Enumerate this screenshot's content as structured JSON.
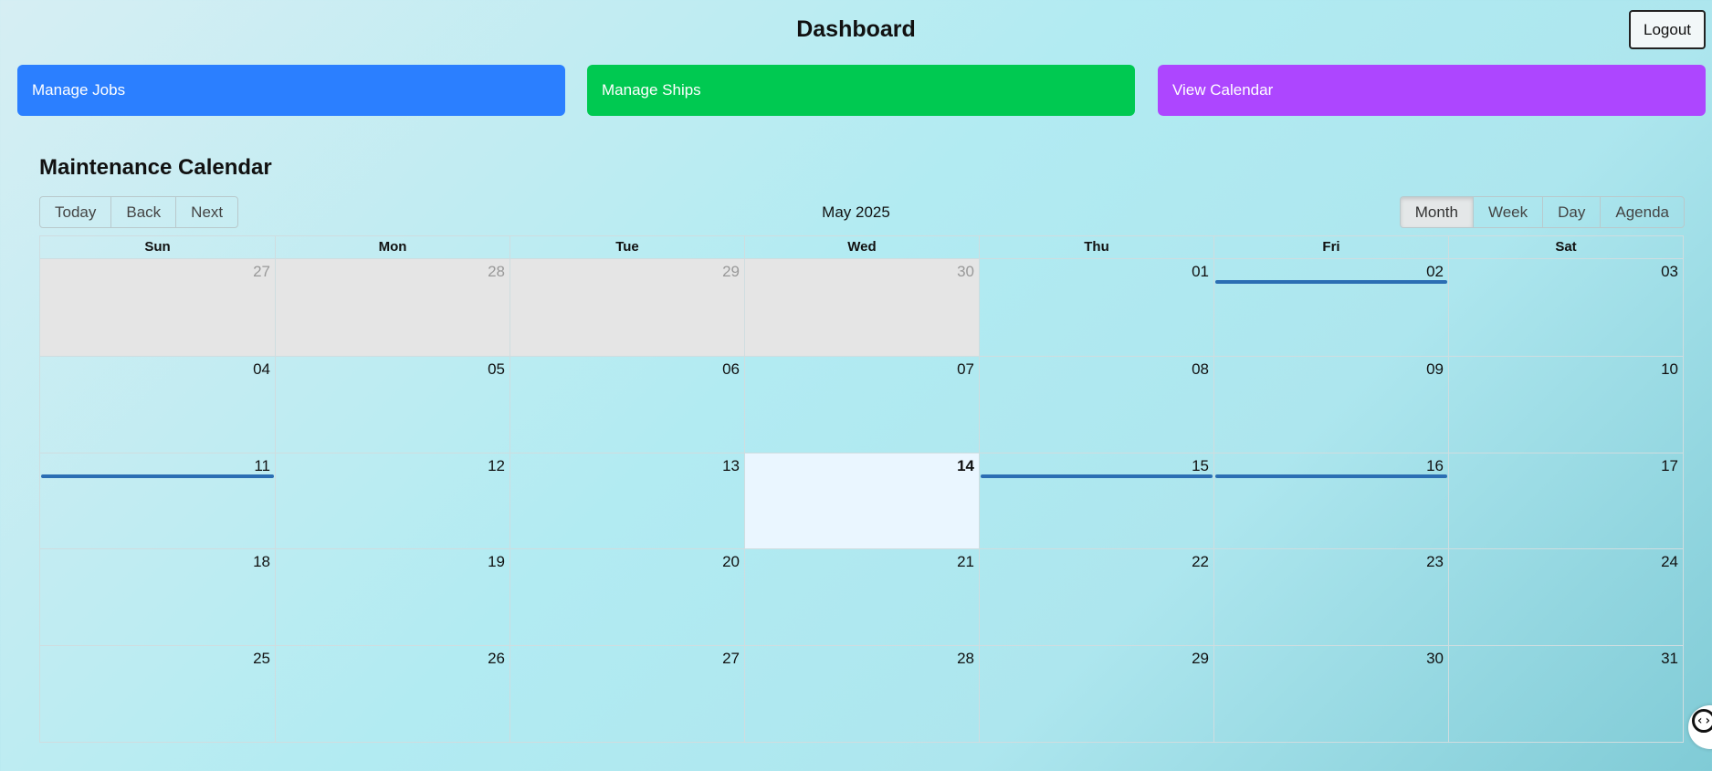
{
  "header": {
    "title": "Dashboard",
    "logout_label": "Logout"
  },
  "nav": [
    {
      "label": "Manage Jobs",
      "color": "#2b7fff",
      "name": "manage-jobs-button"
    },
    {
      "label": "Manage Ships",
      "color": "#00c951",
      "name": "manage-ships-button"
    },
    {
      "label": "View Calendar",
      "color": "#ad46ff",
      "name": "view-calendar-button"
    }
  ],
  "calendar": {
    "title": "Maintenance Calendar",
    "nav_buttons": [
      "Today",
      "Back",
      "Next"
    ],
    "month_label": "May 2025",
    "views": [
      "Month",
      "Week",
      "Day",
      "Agenda"
    ],
    "active_view": "Month",
    "weekdays": [
      "Sun",
      "Mon",
      "Tue",
      "Wed",
      "Thu",
      "Fri",
      "Sat"
    ],
    "days": [
      "27",
      "28",
      "29",
      "30",
      "01",
      "02",
      "03",
      "04",
      "05",
      "06",
      "07",
      "08",
      "09",
      "10",
      "11",
      "12",
      "13",
      "14",
      "15",
      "16",
      "17",
      "18",
      "19",
      "20",
      "21",
      "22",
      "23",
      "24",
      "25",
      "26",
      "27",
      "28",
      "29",
      "30",
      "31"
    ],
    "off_range_count": 4,
    "today_index": 17,
    "event_day_indices": [
      5,
      14,
      18,
      19
    ],
    "event_color": "#2b6eb3"
  },
  "dev_tool": {
    "icon": "code-icon",
    "glyph": "‹›"
  }
}
